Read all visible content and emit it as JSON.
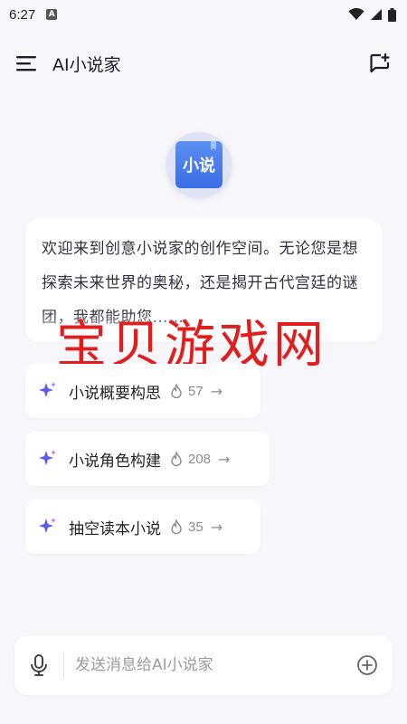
{
  "status_bar": {
    "time": "6:27",
    "notification_badge": "A"
  },
  "app_bar": {
    "title": "AI小说家"
  },
  "logo": {
    "text": "小说"
  },
  "welcome": {
    "text": "欢迎来到创意小说家的创作空间。无论您是想探索未来世界的奥秘，还是揭开古代宫廷的谜团，我都能助您……"
  },
  "watermark": {
    "text": "宝贝游戏网"
  },
  "suggestions": [
    {
      "label": "小说概要构思",
      "count": "57"
    },
    {
      "label": "小说角色构建",
      "count": "208"
    },
    {
      "label": "抽空读本小说",
      "count": "35"
    }
  ],
  "input": {
    "placeholder": "发送消息给AI小说家",
    "value": ""
  },
  "colors": {
    "background": "#f6f6fb",
    "accent": "#3a6de4",
    "watermark": "#e01e1e",
    "sparkle": "#5b5cf0"
  }
}
